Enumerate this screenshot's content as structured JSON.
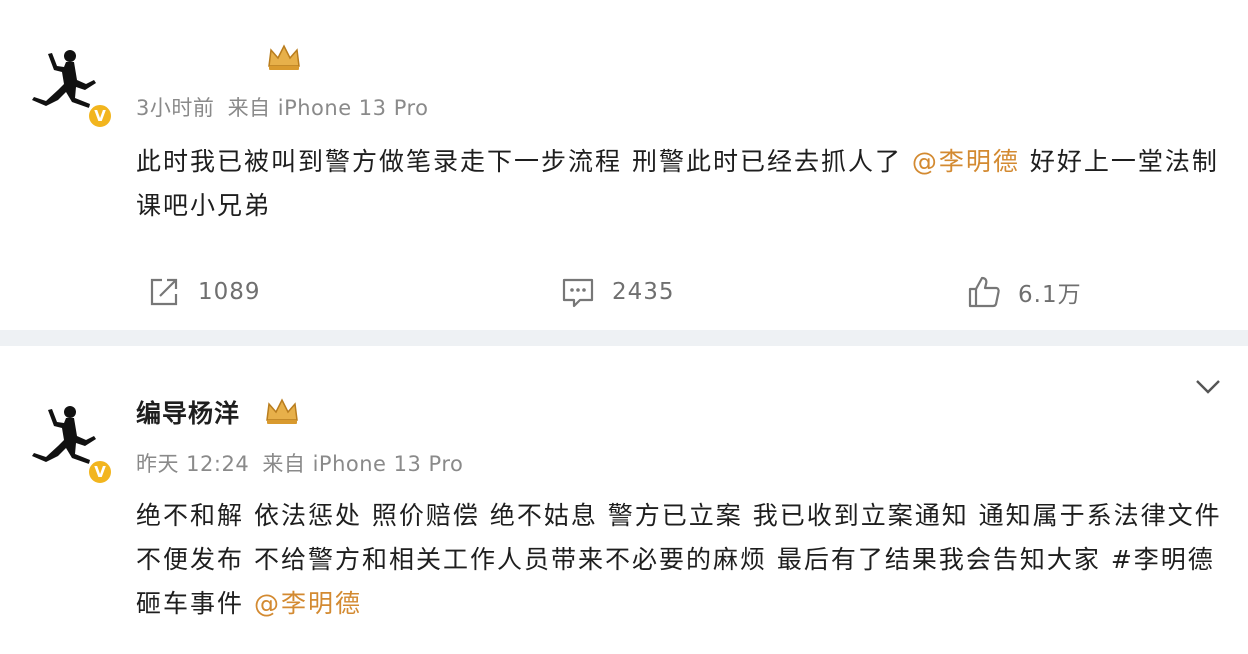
{
  "posts": [
    {
      "username": "",
      "time": "3小时前",
      "source": "来自 iPhone 13 Pro",
      "content_before": "此时我已被叫到警方做笔录走下一步流程 刑警此时已经去抓人了 ",
      "mention": "@李明德",
      "content_after": " 好好上一堂法制课吧小兄弟",
      "reposts": "1089",
      "comments": "2435",
      "likes": "6.1万"
    },
    {
      "username": "编导杨洋",
      "time": "昨天 12:24",
      "source": "来自 iPhone 13 Pro",
      "content_before": "绝不和解 依法惩处 照价赔偿 绝不姑息 警方已立案 我已收到立案通知 通知属于系法律文件 不便发布 不给警方和相关工作人员带来不必要的麻烦 最后有了结果我会告知大家 #李明德砸车事件 ",
      "mention": "@李明德",
      "content_after": ""
    }
  ],
  "icons": {
    "avatar": "jumpman-logo-icon",
    "verified": "verified-v-icon",
    "crown": "crown-badge-icon",
    "repost": "repost-icon",
    "comment": "comment-icon",
    "like": "thumbs-up-icon",
    "menu": "chevron-down-icon"
  },
  "badge_text": "V",
  "colors": {
    "mention": "#d38a31",
    "verified": "#f2b51e",
    "meta": "#8a8a8a"
  }
}
